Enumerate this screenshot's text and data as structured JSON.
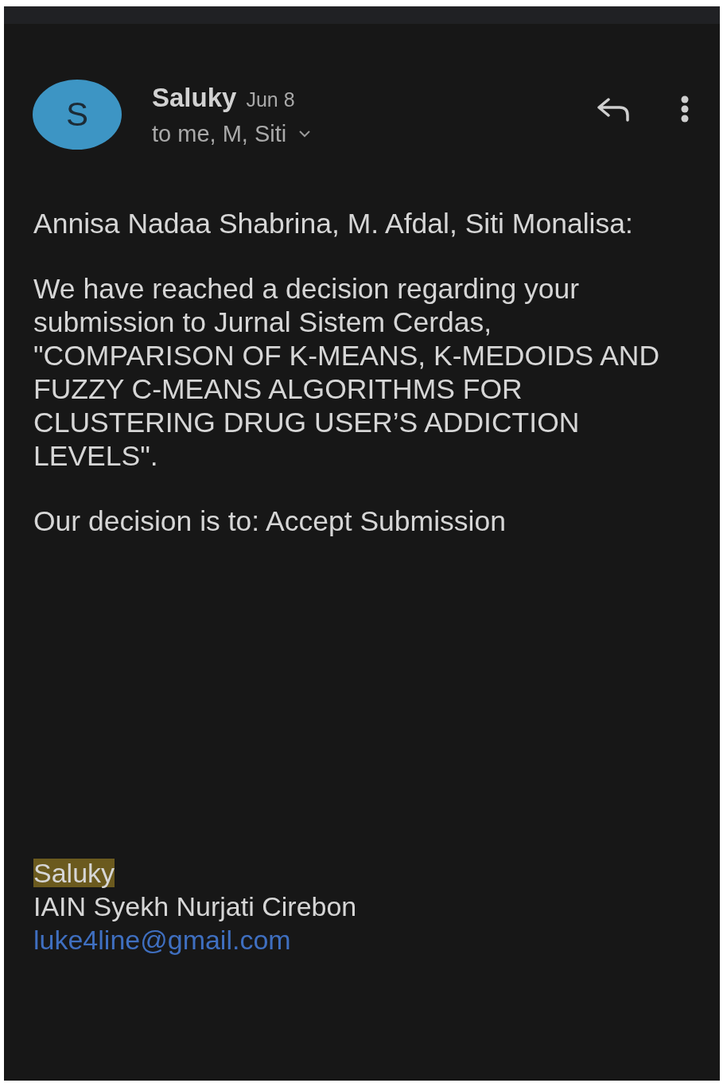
{
  "header": {
    "avatar_letter": "S",
    "sender": "Saluky",
    "date": "Jun 8",
    "recipients": "to me, M, Siti"
  },
  "body": {
    "paragraphs": [
      "Annisa Nadaa Shabrina, M. Afdal, Siti Monalisa:",
      "We have reached a decision regarding your submission to Jurnal Sistem Cerdas, \"COMPARISON OF K-MEANS, K-MEDOIDS AND FUZZY C-MEANS ALGORITHMS FOR CLUSTERING DRUG USER’S ADDICTION LEVELS\".",
      "Our decision is to: Accept Submission"
    ]
  },
  "signature": {
    "name": {
      "text": "Saluky",
      "highlighted": true
    },
    "affiliation": "IAIN Syekh Nurjati Cirebon",
    "email": "luke4line@gmail.com"
  }
}
